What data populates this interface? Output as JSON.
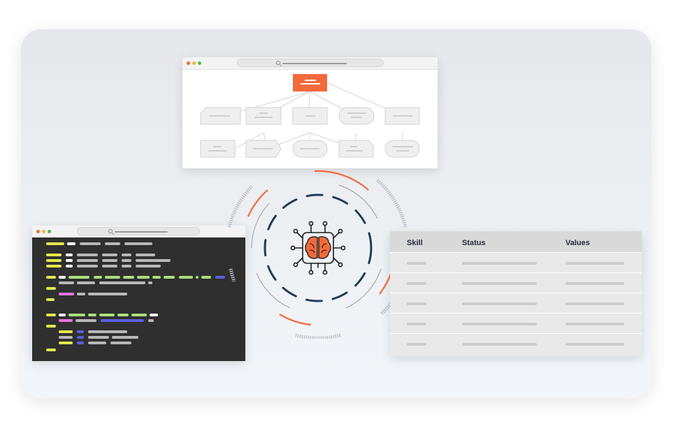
{
  "table": {
    "headers": [
      "Skill",
      "Status",
      "Values"
    ],
    "row_count": 5
  },
  "colors": {
    "accent": "#f26a3c",
    "navy": "#1f3b5a",
    "code_bg": "#2f2f2f",
    "code_yellow": "#e3e84a",
    "code_green": "#a8e07a",
    "code_pink": "#e676d8",
    "code_blue": "#5a5fe0"
  },
  "icons": [
    "brain-chip-icon",
    "search-icon"
  ]
}
